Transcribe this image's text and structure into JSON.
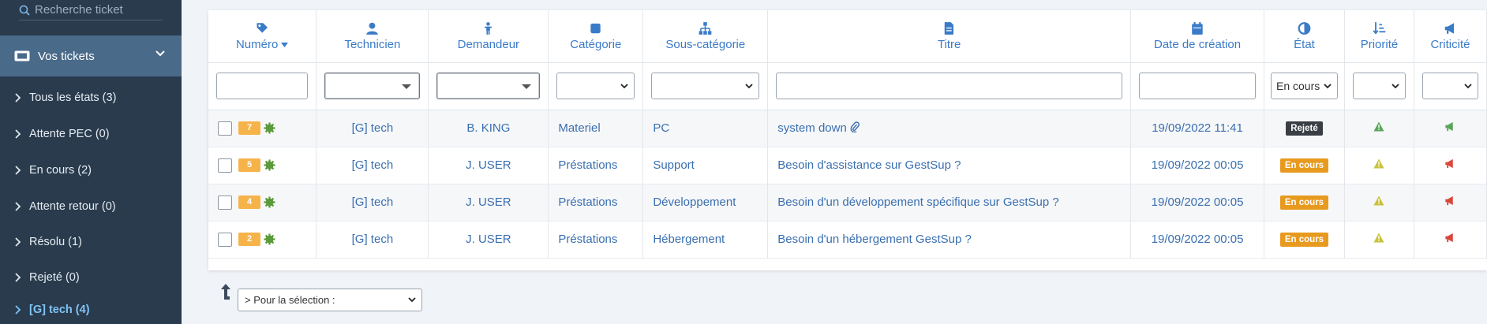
{
  "sidebar": {
    "search_placeholder": "Recherche ticket",
    "section_title": "Vos tickets",
    "items": [
      {
        "label": "Tous les états (3)"
      },
      {
        "label": "Attente PEC (0)"
      },
      {
        "label": "En cours (2)"
      },
      {
        "label": "Attente retour (0)"
      },
      {
        "label": "Résolu (1)"
      },
      {
        "label": "Rejeté (0)"
      },
      {
        "label": "[G] tech (4)",
        "active": true
      }
    ]
  },
  "table": {
    "columns": [
      {
        "label": "Numéro",
        "icon": "tag-icon",
        "sorted": "desc"
      },
      {
        "label": "Technicien",
        "icon": "user-icon"
      },
      {
        "label": "Demandeur",
        "icon": "person-icon"
      },
      {
        "label": "Catégorie",
        "icon": "square-icon"
      },
      {
        "label": "Sous-catégorie",
        "icon": "sitemap-icon"
      },
      {
        "label": "Titre",
        "icon": "file-icon"
      },
      {
        "label": "Date de création",
        "icon": "calendar-icon"
      },
      {
        "label": "État",
        "icon": "half-circle-icon"
      },
      {
        "label": "Priorité",
        "icon": "sort-amount-icon"
      },
      {
        "label": "Criticité",
        "icon": "bullhorn-icon"
      }
    ],
    "filters": {
      "etat_selected": "En cours"
    },
    "rows": [
      {
        "priority": "7",
        "technicien": "[G] tech",
        "demandeur": "B. KING",
        "categorie": "Materiel",
        "sous_categorie": "PC",
        "titre": "system down",
        "attachment": true,
        "date": "19/09/2022 11:41",
        "etat": "Rejeté",
        "etat_color": "#3a3f45",
        "priorite_icon": "warning-icon",
        "priorite_color": "#5aa55a",
        "criticite_color": "#5aa55a"
      },
      {
        "priority": "5",
        "technicien": "[G] tech",
        "demandeur": "J. USER",
        "categorie": "Préstations",
        "sous_categorie": "Support",
        "titre": "Besoin d'assistance sur GestSup ?",
        "attachment": false,
        "date": "19/09/2022 00:05",
        "etat": "En cours",
        "etat_color": "#e89a1e",
        "priorite_icon": "warning-icon",
        "priorite_color": "#c9c23a",
        "criticite_color": "#d9473a"
      },
      {
        "priority": "4",
        "technicien": "[G] tech",
        "demandeur": "J. USER",
        "categorie": "Préstations",
        "sous_categorie": "Développement",
        "titre": "Besoin d'un développement spécifique sur GestSup ?",
        "attachment": false,
        "date": "19/09/2022 00:05",
        "etat": "En cours",
        "etat_color": "#e89a1e",
        "priorite_icon": "warning-icon",
        "priorite_color": "#c9c23a",
        "criticite_color": "#d9473a"
      },
      {
        "priority": "2",
        "technicien": "[G] tech",
        "demandeur": "J. USER",
        "categorie": "Préstations",
        "sous_categorie": "Hébergement",
        "titre": "Besoin d'un hébergement GestSup ?",
        "attachment": false,
        "date": "19/09/2022 00:05",
        "etat": "En cours",
        "etat_color": "#e89a1e",
        "priorite_icon": "warning-icon",
        "priorite_color": "#c9c23a",
        "criticite_color": "#d9473a"
      }
    ]
  },
  "bulk_action": {
    "placeholder": "> Pour la sélection :"
  },
  "colors": {
    "sidebar_bg": "#2a3b4d",
    "sidebar_active_bg": "#4a6a8a",
    "accent": "#3a7bc8",
    "priority_badge": "#f6b34a",
    "status_gear": "#5a9a3a"
  }
}
